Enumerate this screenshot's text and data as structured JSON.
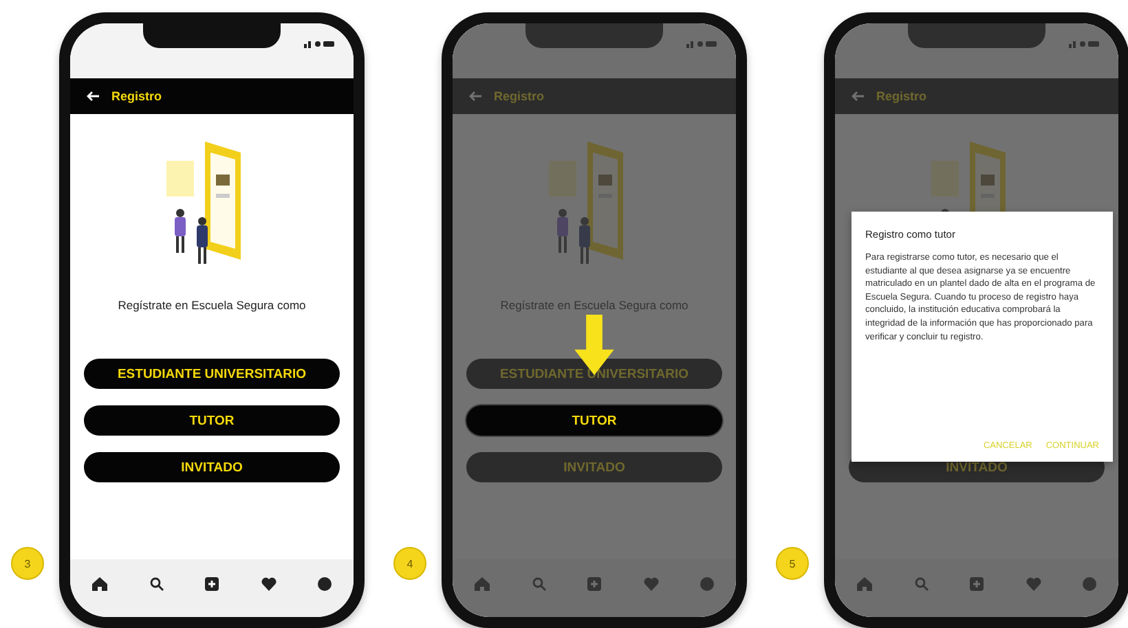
{
  "phones": [
    {
      "step": "3",
      "dimmed": false,
      "pointer": false,
      "header": {
        "title": "Registro"
      },
      "prompt": "Regístrate en Escuela Segura como",
      "buttons": [
        {
          "label": "ESTUDIANTE UNIVERSITARIO",
          "highlighted": false
        },
        {
          "label": "TUTOR",
          "highlighted": false
        },
        {
          "label": "INVITADO",
          "highlighted": false
        }
      ]
    },
    {
      "step": "4",
      "dimmed": true,
      "pointer": true,
      "header": {
        "title": "Registro"
      },
      "prompt": "Regístrate en Escuela Segura como",
      "buttons": [
        {
          "label": "ESTUDIANTE UNIVERSITARIO",
          "highlighted": false
        },
        {
          "label": "TUTOR",
          "highlighted": true
        },
        {
          "label": "INVITADO",
          "highlighted": false
        }
      ]
    },
    {
      "step": "5",
      "dimmed": true,
      "pointer": false,
      "header": {
        "title": "Registro"
      },
      "buttons": [
        {
          "label": "INVITADO",
          "highlighted": false
        }
      ],
      "dialog": {
        "title": "Registro como tutor",
        "body": "Para registrarse como tutor, es necesario que el estudiante al que desea asignarse ya se encuentre matriculado en un plantel dado de alta en el programa de Escuela Segura. Cuando tu proceso de registro haya concluido, la institución educativa comprobará la integridad de la información que has proporcionado para verificar y concluir tu registro.",
        "actions": [
          "CANCELAR",
          "CONTINUAR"
        ]
      }
    }
  ]
}
